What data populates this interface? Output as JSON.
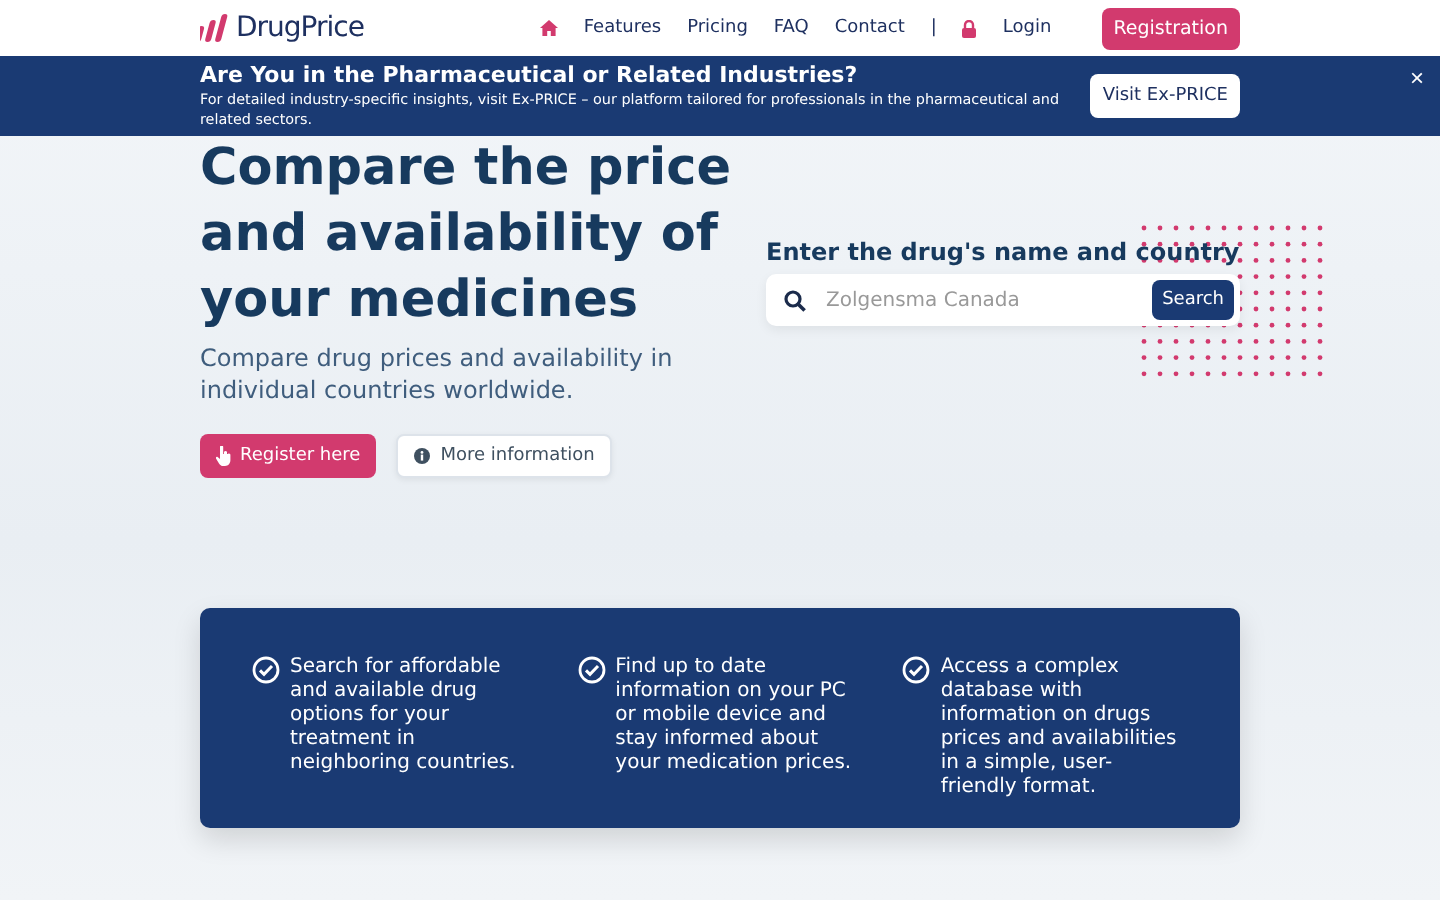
{
  "nav": {
    "logo": "DrugPrice",
    "links": [
      {
        "label": "Features"
      },
      {
        "label": "Pricing"
      },
      {
        "label": "FAQ"
      },
      {
        "label": "Contact"
      }
    ],
    "separator": "|",
    "login": "Login",
    "registration": "Registration"
  },
  "banner": {
    "title": "Are You in the Pharmaceutical or Related Industries?",
    "text": "For detailed industry-specific insights, visit Ex-PRICE – our platform tailored for professionals in the pharmaceutical and related sectors.",
    "button": "Visit Ex-PRICE",
    "close": "×"
  },
  "hero": {
    "heading": "Compare the price and availability of your medicines",
    "subtitle": "Compare drug prices and availability in individual countries worldwide.",
    "register_button": "Register here",
    "info_button": "More information"
  },
  "search": {
    "label": "Enter the drug's name and country",
    "placeholder": "Zolgensma Canada",
    "button": "Search"
  },
  "features": [
    {
      "text": "Search for affordable and available drug options for your treatment in neighboring countries."
    },
    {
      "text": "Find up to date information on your PC or mobile device and stay informed about your medication prices."
    },
    {
      "text": "Access a complex database with information on drugs prices and availabilities in a simple, user-friendly format."
    }
  ]
}
